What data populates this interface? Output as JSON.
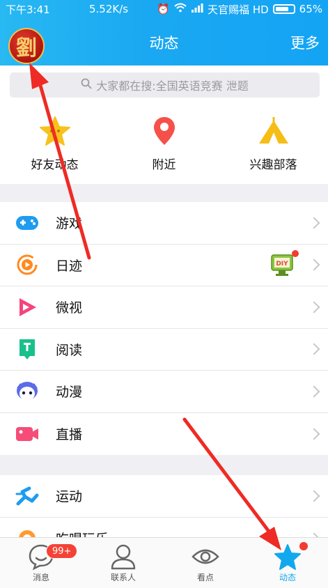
{
  "status_bar": {
    "time": "下午3:41",
    "speed": "5.52K/s",
    "carrier": "天官赐福 HD",
    "battery": "65%"
  },
  "header": {
    "avatar_char": "劉",
    "title": "动态",
    "more": "更多"
  },
  "search": {
    "placeholder": "大家都在搜:全国英语竞赛 泄题"
  },
  "quick_entries": [
    {
      "label": "好友动态",
      "icon": "star-icon"
    },
    {
      "label": "附近",
      "icon": "location-pin-icon"
    },
    {
      "label": "兴趣部落",
      "icon": "tent-icon"
    }
  ],
  "list_group_1": [
    {
      "label": "游戏",
      "icon": "gamepad-icon"
    },
    {
      "label": "日迹",
      "icon": "camera-ring-icon"
    },
    {
      "label": "微视",
      "icon": "play-icon"
    },
    {
      "label": "阅读",
      "icon": "book-icon"
    },
    {
      "label": "动漫",
      "icon": "anime-face-icon"
    },
    {
      "label": "直播",
      "icon": "video-camera-icon"
    }
  ],
  "list_group_2": [
    {
      "label": "运动",
      "icon": "running-icon"
    },
    {
      "label": "吃喝玩乐",
      "icon": "food-icon"
    }
  ],
  "tabs": [
    {
      "label": "消息",
      "badge": "99+"
    },
    {
      "label": "联系人"
    },
    {
      "label": "看点"
    },
    {
      "label": "动态"
    }
  ],
  "colors": {
    "header_blue": "#1aa8f2",
    "active_tab": "#12a8ee",
    "badge_red": "#f44336",
    "annotation_arrow": "#ee2b24"
  }
}
